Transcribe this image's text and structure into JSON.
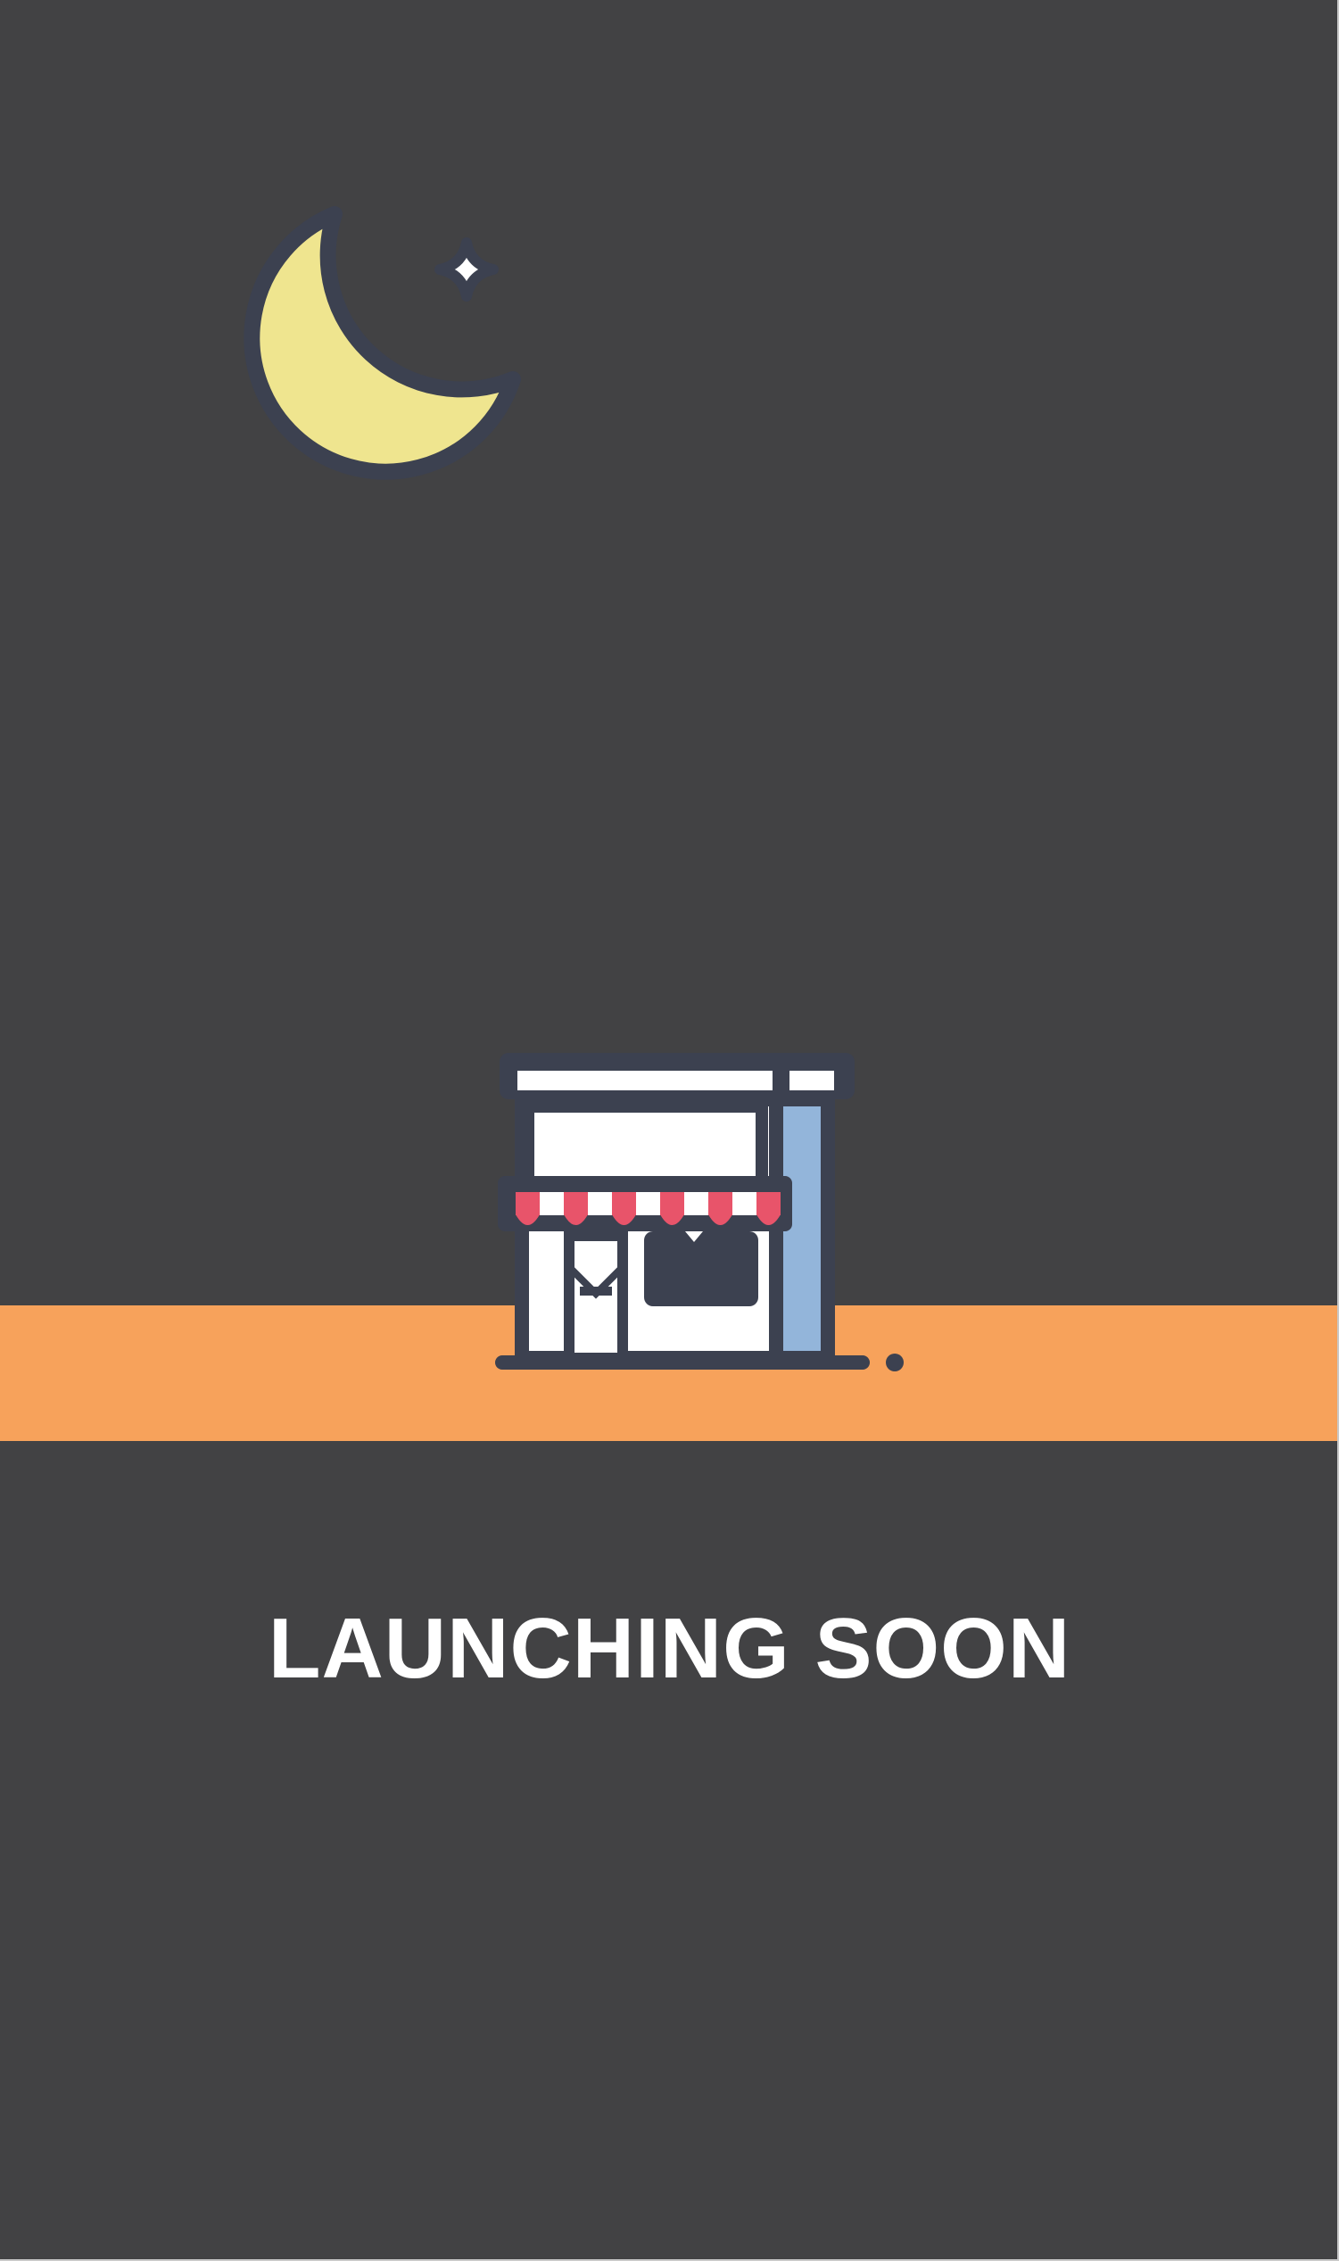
{
  "screen": {
    "headline": "LAUNCHING SOON"
  },
  "icons": {
    "moon": "crescent-moon-icon",
    "star": "sparkle-star-icon",
    "storefront": "storefront-icon"
  },
  "colors": {
    "background": "#424244",
    "ground_band": "#f7a25b",
    "outline": "#3c4150",
    "moon": "#efe58f",
    "awning_red": "#e8546a",
    "window_white": "#ffffff",
    "side_wall_blue": "#93b5da",
    "text": "#ffffff"
  }
}
